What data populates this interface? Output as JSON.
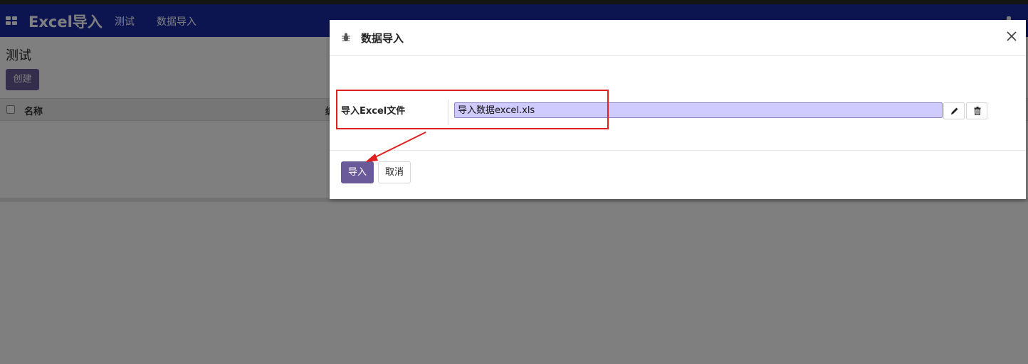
{
  "navbar": {
    "app_title": "Excel导入",
    "items": [
      {
        "label": "测试"
      },
      {
        "label": "数据导入"
      }
    ]
  },
  "page": {
    "title": "测试",
    "create_label": "创建",
    "columns": [
      "名称",
      "编"
    ]
  },
  "modal": {
    "title": "数据导入",
    "field_label": "导入Excel文件",
    "file_name": "导入数据excel.xls",
    "import_label": "导入",
    "cancel_label": "取消"
  },
  "colors": {
    "navbar": "#1a2aa0",
    "primary_button": "#6b5a99",
    "file_input_bg": "#cfcbff",
    "annotation": "#e02020"
  },
  "icons": [
    "apps-grid-icon",
    "bug-icon",
    "close-icon",
    "pencil-icon",
    "trash-icon"
  ]
}
